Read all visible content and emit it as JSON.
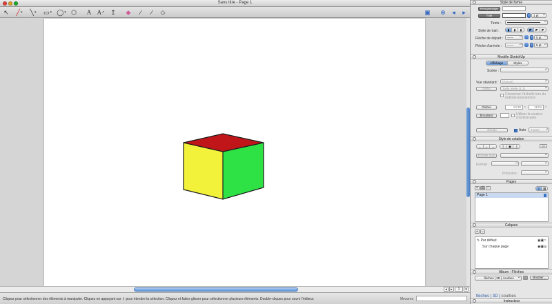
{
  "window": {
    "title": "Sans titre - Page 1"
  },
  "toolbar": {
    "tools": [
      {
        "name": "select-arrow-icon",
        "glyph": "↖"
      },
      {
        "name": "pencil-icon",
        "glyph": "✎"
      },
      {
        "name": "line-tool-icon",
        "glyph": "╱"
      },
      {
        "name": "rectangle-tool-icon",
        "glyph": "□"
      },
      {
        "name": "circle-tool-icon",
        "glyph": "◯"
      },
      {
        "name": "polygon-tool-icon",
        "glyph": "⬡"
      },
      {
        "name": "text-tool-icon",
        "glyph": "A"
      },
      {
        "name": "label-tool-icon",
        "glyph": "A"
      },
      {
        "name": "dimension-tool-icon",
        "glyph": "↥"
      },
      {
        "name": "eraser-icon",
        "glyph": "◆"
      },
      {
        "name": "eyedropper-icon",
        "glyph": "∕"
      },
      {
        "name": "pen-tool-icon",
        "glyph": "∕"
      },
      {
        "name": "paint-bucket-icon",
        "glyph": "◇"
      }
    ],
    "right_icons": [
      {
        "name": "monitor-icon",
        "glyph": "▣"
      },
      {
        "name": "add-page-icon",
        "glyph": "+"
      },
      {
        "name": "previous-page-icon",
        "glyph": "◂"
      },
      {
        "name": "next-page-icon",
        "glyph": "▸"
      }
    ]
  },
  "cube": {
    "top_color": "#c0161a",
    "left_color": "#f3f23a",
    "right_color": "#2ee245",
    "edge_color": "#1a1a1a"
  },
  "statusbar": {
    "text": "Cliquez pour sélectionner des éléments à manipuler. Cliquez en appuyant sur ⇧ pour étendre la sélection. Cliquez et faites glisser pour sélectionner plusieurs éléments. Double-cliquez pour ouvrir l’éditeur.",
    "measure_label": "Mesures"
  },
  "zoom": {
    "value": "1"
  },
  "inspector": {
    "shape_style": {
      "title": "Style de forme",
      "fill_button": "Remplissage",
      "stroke_button": "Trait",
      "stroke_width": "1 pt",
      "dashes_label": "Tirets :",
      "stroke_style_label": "Style de trait :",
      "start_arrow_label": "Flèche de départ :",
      "start_arrow_size": "5 pt",
      "end_arrow_label": "Flèche d’arrivée :",
      "end_arrow_size": "5 pt"
    },
    "sketchup_model": {
      "title": "Modèle SketchUp",
      "tabs": [
        "Affichage",
        "Styles"
      ],
      "active_tab": "Affichage",
      "scene_label": "Scène :",
      "standard_view_label": "Vue standard :",
      "standard_view_value": "(Aucun)",
      "ortho_button": "Ortho",
      "real_size_value": "Taille réelle (1:1)",
      "preserve_scale_label": "Conserver l’échelle lors du redimensionnement",
      "shadows_button": "Ombre",
      "time_value": "13:30",
      "date_value": "11/04",
      "fog_button": "Brouillard",
      "bg_color_label": "Utiliser la couleur d’arrière-plan",
      "render_button": "Rendu",
      "auto_label": "Auto",
      "auto_checked": true,
      "render_mode": "Trame"
    },
    "dimension_style": {
      "title": "Style de cotation",
      "auto_scale_button": "Échelle auto",
      "format_label": "Format :",
      "precision_label": "Précision :"
    },
    "pages": {
      "title": "Pages",
      "items": [
        "Page 1"
      ]
    },
    "layers": {
      "title": "Calques",
      "items": [
        "Par défaut",
        "Sur chaque page"
      ]
    },
    "scrapbooks": {
      "title": "Album - Flèches",
      "selected": "flèches | 3D | courbes",
      "modify_button": "Modifier..."
    },
    "bottom_tabs": {
      "current": "flèches | 3D |",
      "other": "courbes"
    },
    "instructor": {
      "title": "Instructeur"
    }
  }
}
